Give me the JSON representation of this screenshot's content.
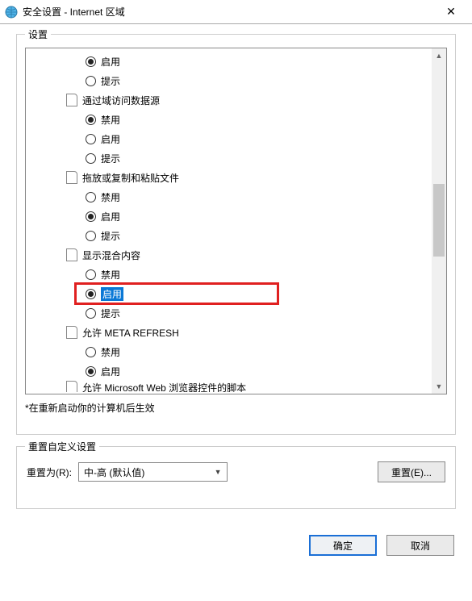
{
  "titlebar": {
    "title": "安全设置 - Internet 区域"
  },
  "groupSettings": {
    "legend": "设置"
  },
  "tree": [
    {
      "indent": 2,
      "type": "radio",
      "checked": true,
      "label": "启用"
    },
    {
      "indent": 2,
      "type": "radio",
      "checked": false,
      "label": "提示"
    },
    {
      "indent": 1,
      "type": "category",
      "label": "通过域访问数据源"
    },
    {
      "indent": 2,
      "type": "radio",
      "checked": true,
      "label": "禁用"
    },
    {
      "indent": 2,
      "type": "radio",
      "checked": false,
      "label": "启用"
    },
    {
      "indent": 2,
      "type": "radio",
      "checked": false,
      "label": "提示"
    },
    {
      "indent": 1,
      "type": "category",
      "label": "拖放或复制和粘贴文件"
    },
    {
      "indent": 2,
      "type": "radio",
      "checked": false,
      "label": "禁用"
    },
    {
      "indent": 2,
      "type": "radio",
      "checked": true,
      "label": "启用"
    },
    {
      "indent": 2,
      "type": "radio",
      "checked": false,
      "label": "提示"
    },
    {
      "indent": 1,
      "type": "category",
      "label": "显示混合内容"
    },
    {
      "indent": 2,
      "type": "radio",
      "checked": false,
      "label": "禁用"
    },
    {
      "indent": 2,
      "type": "radio",
      "checked": true,
      "label": "启用",
      "selected": true,
      "highlight": true
    },
    {
      "indent": 2,
      "type": "radio",
      "checked": false,
      "label": "提示"
    },
    {
      "indent": 1,
      "type": "category",
      "label": "允许 META REFRESH"
    },
    {
      "indent": 2,
      "type": "radio",
      "checked": false,
      "label": "禁用"
    },
    {
      "indent": 2,
      "type": "radio",
      "checked": true,
      "label": "启用"
    },
    {
      "indent": 1,
      "type": "category-partial",
      "label": "允许 Microsoft Web 浏览器控件的脚本"
    }
  ],
  "note": "*在重新启动你的计算机后生效",
  "reset": {
    "legend": "重置自定义设置",
    "label": "重置为(R):",
    "selectValue": "中-高 (默认值)",
    "button": "重置(E)..."
  },
  "footer": {
    "ok": "确定",
    "cancel": "取消"
  }
}
